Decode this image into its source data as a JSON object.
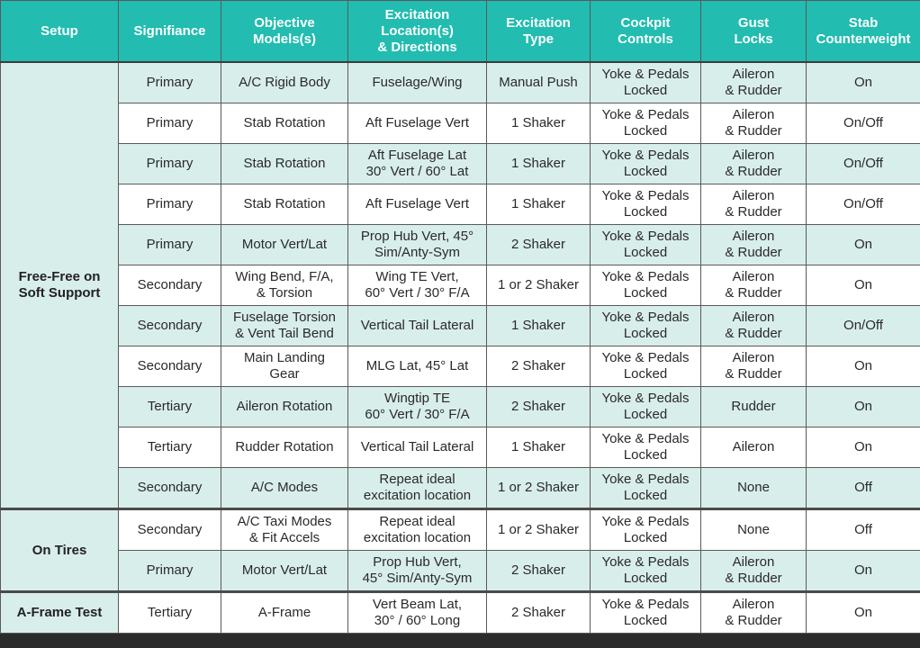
{
  "header": [
    "Setup",
    "Signifiance",
    "Objective\nModels(s)",
    "Excitation\nLocation(s)\n& Directions",
    "Excitation\nType",
    "Cockpit\nControls",
    "Gust\nLocks",
    "Stab\nCounterweight"
  ],
  "groups": [
    {
      "setup": "Free-Free on\nSoft Support",
      "rows": [
        [
          "Primary",
          "A/C Rigid Body",
          "Fuselage/Wing",
          "Manual Push",
          "Yoke & Pedals\nLocked",
          "Aileron\n& Rudder",
          "On"
        ],
        [
          "Primary",
          "Stab Rotation",
          "Aft Fuselage Vert",
          "1 Shaker",
          "Yoke & Pedals\nLocked",
          "Aileron\n& Rudder",
          "On/Off"
        ],
        [
          "Primary",
          "Stab Rotation",
          "Aft Fuselage Lat\n30° Vert / 60° Lat",
          "1 Shaker",
          "Yoke & Pedals\nLocked",
          "Aileron\n& Rudder",
          "On/Off"
        ],
        [
          "Primary",
          "Stab Rotation",
          "Aft Fuselage Vert",
          "1 Shaker",
          "Yoke & Pedals\nLocked",
          "Aileron\n& Rudder",
          "On/Off"
        ],
        [
          "Primary",
          "Motor Vert/Lat",
          "Prop Hub Vert, 45°\nSim/Anty-Sym",
          "2 Shaker",
          "Yoke & Pedals\nLocked",
          "Aileron\n& Rudder",
          "On"
        ],
        [
          "Secondary",
          "Wing Bend, F/A,\n& Torsion",
          "Wing TE Vert,\n60° Vert / 30° F/A",
          "1 or 2 Shaker",
          "Yoke & Pedals\nLocked",
          "Aileron\n& Rudder",
          "On"
        ],
        [
          "Secondary",
          "Fuselage Torsion\n& Vent Tail Bend",
          "Vertical Tail Lateral",
          "1 Shaker",
          "Yoke & Pedals\nLocked",
          "Aileron\n& Rudder",
          "On/Off"
        ],
        [
          "Secondary",
          "Main Landing\nGear",
          "MLG Lat, 45° Lat",
          "2 Shaker",
          "Yoke & Pedals\nLocked",
          "Aileron\n& Rudder",
          "On"
        ],
        [
          "Tertiary",
          "Aileron Rotation",
          "Wingtip TE\n60° Vert / 30° F/A",
          "2 Shaker",
          "Yoke & Pedals\nLocked",
          "Rudder",
          "On"
        ],
        [
          "Tertiary",
          "Rudder Rotation",
          "Vertical Tail Lateral",
          "1 Shaker",
          "Yoke & Pedals\nLocked",
          "Aileron",
          "On"
        ],
        [
          "Secondary",
          "A/C Modes",
          "Repeat ideal\nexcitation location",
          "1 or 2 Shaker",
          "Yoke & Pedals\nLocked",
          "None",
          "Off"
        ]
      ]
    },
    {
      "setup": "On Tires",
      "rows": [
        [
          "Secondary",
          "A/C Taxi Modes\n& Fit Accels",
          "Repeat ideal\nexcitation location",
          "1 or 2 Shaker",
          "Yoke & Pedals\nLocked",
          "None",
          "Off"
        ],
        [
          "Primary",
          "Motor Vert/Lat",
          "Prop Hub Vert,\n45° Sim/Anty-Sym",
          "2 Shaker",
          "Yoke & Pedals\nLocked",
          "Aileron\n& Rudder",
          "On"
        ]
      ]
    },
    {
      "setup": "A-Frame Test",
      "rows": [
        [
          "Tertiary",
          "A-Frame",
          "Vert Beam Lat,\n30° / 60° Long",
          "2 Shaker",
          "Yoke & Pedals\nLocked",
          "Aileron\n& Rudder",
          "On"
        ]
      ]
    }
  ],
  "colors": {
    "header_bg": "#22bcb0",
    "row_shaded": "#d8eeeb",
    "row_plain": "#ffffff",
    "border": "#5a5a5a"
  }
}
